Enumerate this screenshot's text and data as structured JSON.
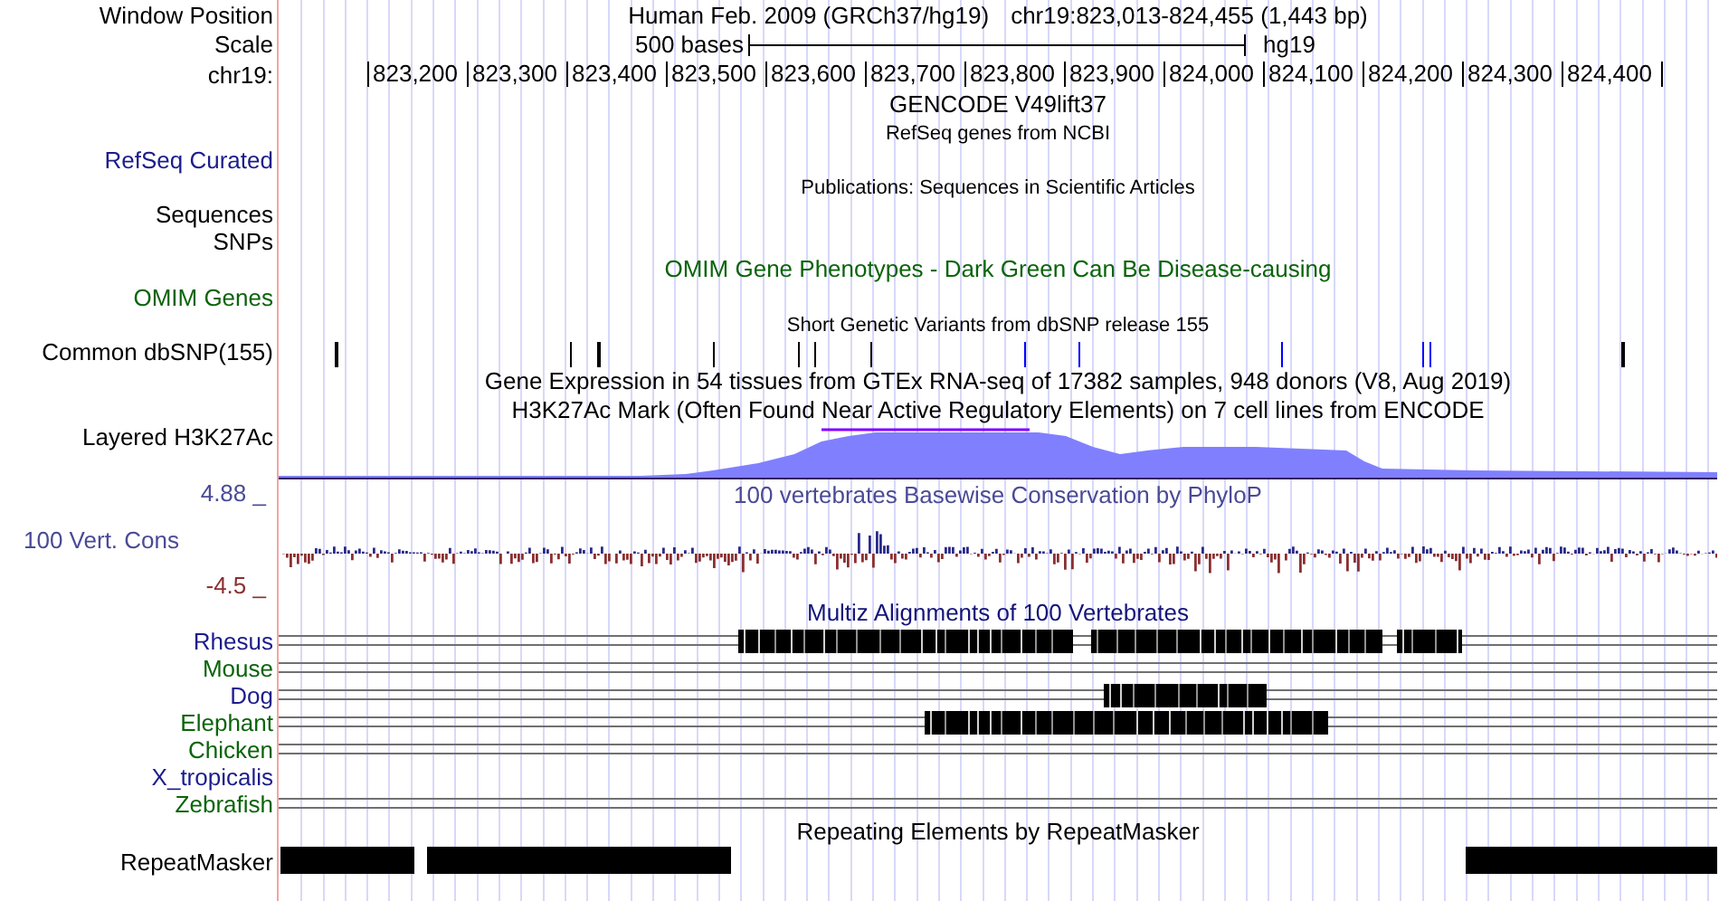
{
  "position": {
    "label": "Window Position",
    "assembly": "Human Feb. 2009 (GRCh37/hg19)",
    "range": "chr19:823,013-824,455 (1,443 bp)"
  },
  "scale": {
    "label": "Scale",
    "length": "500 bases",
    "assembly": "hg19"
  },
  "ruler": {
    "label": "chr19:",
    "ticks": [
      "823,200",
      "823,300",
      "823,400",
      "823,500",
      "823,600",
      "823,700",
      "823,800",
      "823,900",
      "824,000",
      "824,100",
      "824,200",
      "824,300",
      "824,400"
    ]
  },
  "rows": [
    {
      "kind": "title",
      "title": "GENCODE V49lift37",
      "color": "#000000"
    },
    {
      "kind": "caption",
      "title": "RefSeq genes from NCBI",
      "color": "#000000"
    },
    {
      "kind": "label",
      "label": "RefSeq Curated",
      "color": "#1c1c8c"
    },
    {
      "kind": "caption",
      "title": "Publications: Sequences in Scientific Articles",
      "color": "#000000"
    },
    {
      "kind": "label",
      "label": "Sequences",
      "color": "#000000"
    },
    {
      "kind": "label",
      "label": "SNPs",
      "color": "#000000"
    },
    {
      "kind": "title",
      "title": "OMIM Gene Phenotypes - Dark Green Can Be Disease-causing",
      "color": "#0a640a"
    },
    {
      "kind": "label",
      "label": "OMIM Genes",
      "color": "#0a640a"
    },
    {
      "kind": "caption",
      "title": "Short Genetic Variants from dbSNP release 155",
      "color": "#000000"
    },
    {
      "kind": "snps",
      "label": "Common dbSNP(155)",
      "color": "#000000"
    },
    {
      "kind": "title",
      "title": "Gene Expression in 54 tissues from GTEx RNA-seq of 17382 samples, 948 donors (V8, Aug 2019)",
      "color": "#000000"
    },
    {
      "kind": "title",
      "title": "H3K27Ac Mark (Often Found Near Active Regulatory Elements) on 7 cell lines from ENCODE",
      "color": "#000000"
    },
    {
      "kind": "signal",
      "label": "Layered H3K27Ac",
      "color": "#000000"
    },
    {
      "kind": "wiggle",
      "label": "100 Vert. Cons",
      "title": "100 vertebrates Basewise Conservation by PhyloP",
      "max": "4.88 _",
      "min": "-4.5 _",
      "color": "#4a4a96"
    },
    {
      "kind": "title",
      "title": "Multiz Alignments of 100 Vertebrates",
      "color": "#14147a"
    },
    {
      "kind": "alignment",
      "label": "Rhesus",
      "color": "#1c1c8c",
      "aligned": true
    },
    {
      "kind": "alignment",
      "label": "Mouse",
      "color": "#0a640a",
      "aligned": true
    },
    {
      "kind": "alignment",
      "label": "Dog",
      "color": "#1c1c8c",
      "aligned": true
    },
    {
      "kind": "alignment",
      "label": "Elephant",
      "color": "#0a640a",
      "aligned": true
    },
    {
      "kind": "alignment",
      "label": "Chicken",
      "color": "#0a640a",
      "aligned": true
    },
    {
      "kind": "alignment",
      "label": "X_tropicalis",
      "color": "#1c1c8c",
      "aligned": false
    },
    {
      "kind": "alignment",
      "label": "Zebrafish",
      "color": "#0a640a",
      "aligned": true
    },
    {
      "kind": "title",
      "title": "Repeating Elements by RepeatMasker",
      "color": "#000000"
    },
    {
      "kind": "repeats",
      "label": "RepeatMasker",
      "color": "#000000"
    }
  ]
}
